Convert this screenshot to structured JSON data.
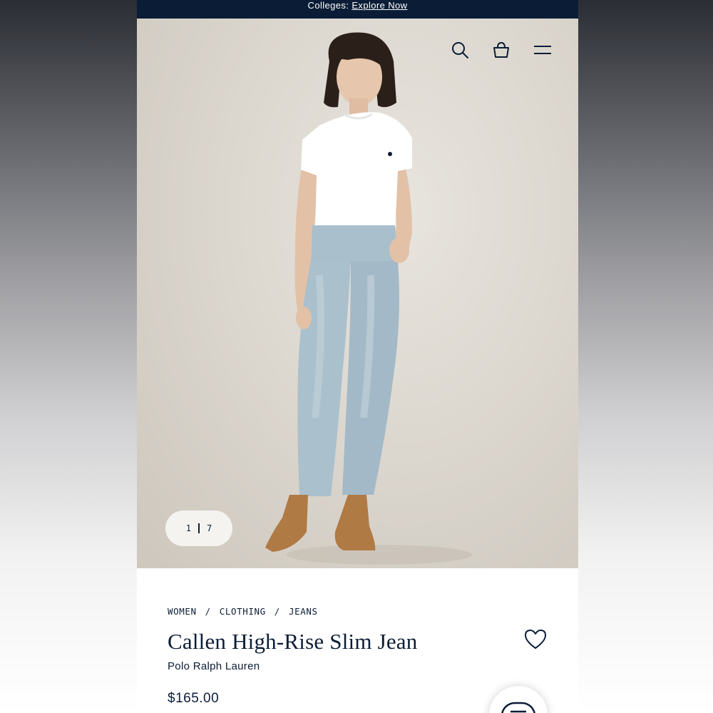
{
  "promo": {
    "prefix": "Colleges:",
    "link_label": "Explore Now"
  },
  "header": {
    "icons": [
      "search-icon",
      "shopping-bag-icon",
      "menu-icon"
    ]
  },
  "gallery": {
    "current": "1",
    "total": "7"
  },
  "breadcrumb": {
    "items": [
      "WOMEN",
      "CLOTHING",
      "JEANS"
    ],
    "separator": "/"
  },
  "product": {
    "title": "Callen High-Rise Slim Jean",
    "brand": "Polo Ralph Lauren",
    "price": "$165.00"
  },
  "colors": {
    "navy": "#0b1d36",
    "backdrop": "#dcd7cf",
    "denim": "#a9bfcc",
    "boot": "#b07a44"
  }
}
